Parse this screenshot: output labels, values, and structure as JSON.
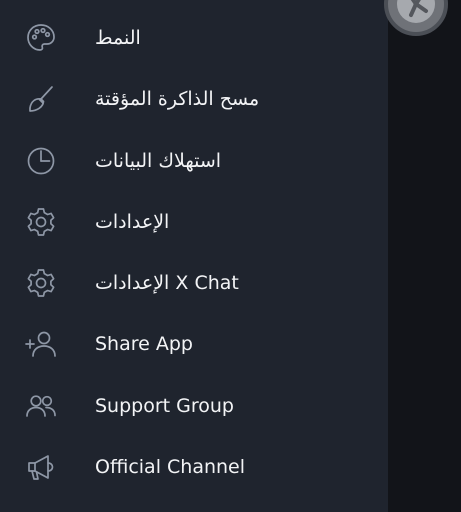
{
  "menu": {
    "items": [
      {
        "label": "النمط",
        "icon": "palette-icon"
      },
      {
        "label": "مسح الذاكرة المؤقتة",
        "icon": "broom-icon"
      },
      {
        "label": "استهلاك البيانات",
        "icon": "pie-chart-icon"
      },
      {
        "label": "الإعدادات",
        "icon": "gear-icon"
      },
      {
        "label": "الإعدادات X Chat",
        "icon": "gear-icon"
      },
      {
        "label": "Share App",
        "icon": "add-user-icon"
      },
      {
        "label": "Support Group",
        "icon": "users-icon"
      },
      {
        "label": "Official Channel",
        "icon": "megaphone-icon"
      }
    ]
  },
  "colors": {
    "drawer_bg": "#1f242e",
    "scrim_bg": "#121419",
    "icon": "#8e97a6",
    "text": "#f3f4f6"
  }
}
